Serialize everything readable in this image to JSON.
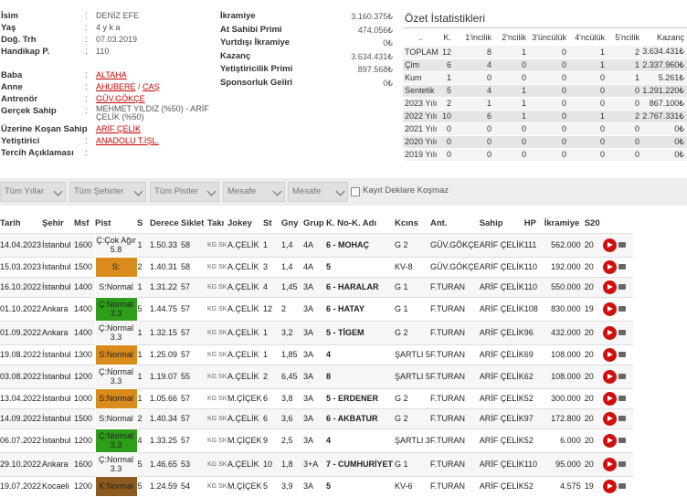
{
  "horse": {
    "name_label": "İsim",
    "name": "DENİZ EFE",
    "age_label": "Yaş",
    "age": "4 y k a",
    "birth_label": "Doğ. Trh",
    "birth": "07.03.2019",
    "hcap_label": "Handikap P.",
    "hcap": "110",
    "father_label": "Baba",
    "father": "ALTAHA",
    "mother_label": "Anne",
    "mother1": "AHUBERE",
    "mother_sep": " / ",
    "mother2": "CAŞ",
    "trainer_label": "Antrenör",
    "trainer": "GÜV.GÖKÇE",
    "owner_label": "Gerçek Sahip",
    "owner": "MEHMET YILDIZ (%50) - ARİF ÇELİK (%50)",
    "runner_label": "Üzerine Koşan Sahip",
    "runner": "ARİF ÇELİK",
    "breeder_label": "Yetiştirici",
    "breeder": "ANADOLU T.İŞL.",
    "pref_label": "Tercih Açıklaması",
    "pref": ""
  },
  "prizes": [
    {
      "label": "İkramiye",
      "value": "3.160.375₺"
    },
    {
      "label": "At Sahibi Primi",
      "value": "474.056₺"
    },
    {
      "label": "Yurtdışı İkramiye",
      "value": "0₺"
    },
    {
      "label": "Kazanç",
      "value": "3.634.431₺"
    },
    {
      "label": "Yetiştiricilik Primi",
      "value": "897.568₺"
    },
    {
      "label": "Sponsorluk Geliri",
      "value": "0₺"
    }
  ],
  "stats": {
    "title": "Özet İstatistikleri",
    "headers": [
      "..",
      "K.",
      "1'incilik",
      "2'ncilik",
      "3'üncülük",
      "4'ncülük",
      "5'ncilik",
      "Kazanç"
    ],
    "rows": [
      [
        "TOPLAM",
        "12",
        "8",
        "1",
        "0",
        "1",
        "2",
        "3.634.431₺"
      ],
      [
        "Çim",
        "6",
        "4",
        "0",
        "0",
        "1",
        "1",
        "2.337.960₺"
      ],
      [
        "Kum",
        "1",
        "0",
        "0",
        "0",
        "0",
        "1",
        "5.261₺"
      ],
      [
        "Sentetik",
        "5",
        "4",
        "1",
        "0",
        "0",
        "0",
        "1.291.220₺"
      ],
      [
        "2023 Yılı",
        "2",
        "1",
        "1",
        "0",
        "0",
        "0",
        "867.100₺"
      ],
      [
        "2022 Yılı",
        "10",
        "6",
        "1",
        "0",
        "1",
        "2",
        "2.767.331₺"
      ],
      [
        "2021 Yılı",
        "0",
        "0",
        "0",
        "0",
        "0",
        "0",
        "0₺"
      ],
      [
        "2020 Yılı",
        "0",
        "0",
        "0",
        "0",
        "0",
        "0",
        "0₺"
      ],
      [
        "2019 Yılı",
        "0",
        "0",
        "0",
        "0",
        "0",
        "0",
        "0₺"
      ]
    ]
  },
  "filters": {
    "years": "Tüm Yıllar",
    "cities": "Tüm Şehirler",
    "tracks": "Tüm Pistler",
    "dist1": "Mesafe",
    "dist2": "Mesafe",
    "checkbox_label": "Kayıt Deklare Koşmaz"
  },
  "grid": {
    "headers": [
      "Tarih",
      "Şehir",
      "Msf",
      "Pist",
      "S",
      "Derece",
      "Siklet",
      "Takı",
      "Jokey",
      "St",
      "Gny",
      "Grup",
      "K. No-K. Adı",
      "Kcıns",
      "Ant.",
      "Sahip",
      "HP",
      "İkramiye",
      "S20"
    ],
    "rows": [
      {
        "d": "14.04.2023",
        "c": "İstanbul",
        "m": "1600",
        "p": "Ç:Çok Ağır 5.8",
        "pc": "g",
        "s": "1",
        "dr": "1.50.33",
        "sk": "58",
        "t": "KG SK",
        "j": "A.ÇELİK",
        "st": "1",
        "g": "1,4",
        "gr": "4A",
        "k": "6 - MOHAÇ",
        "kc": "G 2",
        "a": "GÜV.GÖKÇE",
        "sa": "ARİF ÇELİK",
        "hp": "111",
        "ik": "562.000",
        "s20": "20"
      },
      {
        "d": "15.03.2023",
        "c": "İstanbul",
        "m": "1500",
        "p": "S:",
        "pc": "b",
        "s": "2",
        "dr": "1.40.31",
        "sk": "58",
        "t": "KG SK",
        "j": "A.ÇELİK",
        "st": "3",
        "g": "1,4",
        "gr": "4A",
        "k": "5",
        "kc": "KV-8",
        "a": "GÜV.GÖKÇE",
        "sa": "ARİF ÇELİK",
        "hp": "110",
        "ik": "192.000",
        "s20": "20"
      },
      {
        "d": "16.10.2022",
        "c": "İstanbul",
        "m": "1400",
        "p": "S:Normal",
        "pc": "b",
        "s": "1",
        "dr": "1.31.22",
        "sk": "57",
        "t": "KG SK",
        "j": "A.ÇELİK",
        "st": "4",
        "g": "1,45",
        "gr": "3A",
        "k": "6 - HARALAR",
        "kc": "G 1",
        "a": "F.TURAN",
        "sa": "ARİF ÇELİK",
        "hp": "110",
        "ik": "550.000",
        "s20": "20"
      },
      {
        "d": "01.10.2022",
        "c": "Ankara",
        "m": "1400",
        "p": "Ç:Normal 3.3",
        "pc": "g",
        "s": "5",
        "dr": "1.44.75",
        "sk": "57",
        "t": "KG SK",
        "j": "A.ÇELİK",
        "st": "12",
        "g": "2",
        "gr": "3A",
        "k": "6 - HATAY",
        "kc": "G 1",
        "a": "F.TURAN",
        "sa": "ARİF ÇELİK",
        "hp": "108",
        "ik": "830.000",
        "s20": "19"
      },
      {
        "d": "01.09.2022",
        "c": "Ankara",
        "m": "1400",
        "p": "Ç:Normal 3.3",
        "pc": "g",
        "s": "1",
        "dr": "1.32.15",
        "sk": "57",
        "t": "KG SK",
        "j": "A.ÇELİK",
        "st": "1",
        "g": "3,2",
        "gr": "3A",
        "k": "5 - TİGEM",
        "kc": "G 2",
        "a": "F.TURAN",
        "sa": "ARİF ÇELİK",
        "hp": "96",
        "ik": "432.000",
        "s20": "20"
      },
      {
        "d": "19.08.2022",
        "c": "İstanbul",
        "m": "1300",
        "p": "S:Normal",
        "pc": "b",
        "s": "1",
        "dr": "1.25.09",
        "sk": "57",
        "t": "KG SK",
        "j": "A.ÇELİK",
        "st": "1",
        "g": "1,85",
        "gr": "3A",
        "k": "4",
        "kc": "ŞARTLI 5",
        "a": "F.TURAN",
        "sa": "ARİF ÇELİK",
        "hp": "69",
        "ik": "108.000",
        "s20": "20"
      },
      {
        "d": "03.08.2022",
        "c": "İstanbul",
        "m": "1200",
        "p": "Ç:Normal 3.3",
        "pc": "g",
        "s": "1",
        "dr": "1.19.07",
        "sk": "55",
        "t": "KG SK",
        "j": "A.ÇELİK",
        "st": "2",
        "g": "6,45",
        "gr": "3A",
        "k": "8",
        "kc": "ŞARTLI 5",
        "a": "F.TURAN",
        "sa": "ARİF ÇELİK",
        "hp": "62",
        "ik": "108.000",
        "s20": "20"
      },
      {
        "d": "13.04.2022",
        "c": "İstanbul",
        "m": "1000",
        "p": "S:Normal",
        "pc": "b",
        "s": "1",
        "dr": "1.05.66",
        "sk": "57",
        "t": "KG SK",
        "j": "M.ÇİÇEK",
        "st": "6",
        "g": "3,8",
        "gr": "3A",
        "k": "5 - ERDENER",
        "kc": "G 2",
        "a": "F.TURAN",
        "sa": "ARİF ÇELİK",
        "hp": "52",
        "ik": "300.000",
        "s20": "20"
      },
      {
        "d": "14.09.2022",
        "c": "İstanbul",
        "m": "1500",
        "p": "S:Normal",
        "pc": "b",
        "s": "2",
        "dr": "1.40.34",
        "sk": "57",
        "t": "KG SK",
        "j": "A.ÇELİK",
        "st": "6",
        "g": "3,6",
        "gr": "3A",
        "k": "6 - AKBATUR",
        "kc": "G 2",
        "a": "F.TURAN",
        "sa": "ARİF ÇELİK",
        "hp": "97",
        "ik": "172.800",
        "s20": "20"
      },
      {
        "d": "06.07.2022",
        "c": "İstanbul",
        "m": "1200",
        "p": "Ç:Normal 3.3",
        "pc": "g",
        "s": "4",
        "dr": "1.33.25",
        "sk": "57",
        "t": "KG SK",
        "j": "M.ÇİÇEK",
        "st": "9",
        "g": "2,5",
        "gr": "3A",
        "k": "4",
        "kc": "ŞARTLI 3",
        "a": "F.TURAN",
        "sa": "ARİF ÇELİK",
        "hp": "52",
        "ik": "6.000",
        "s20": "20"
      },
      {
        "d": "29.10.2022",
        "c": "Ankara",
        "m": "1600",
        "p": "Ç:Normal 3.3",
        "pc": "g",
        "s": "5",
        "dr": "1.46.65",
        "sk": "53",
        "t": "KG SK",
        "j": "A.ÇELİK",
        "st": "10",
        "g": "1,8",
        "gr": "3+A",
        "k": "7 - CUMHURİYET",
        "kc": "G 1",
        "a": "F.TURAN",
        "sa": "ARİF ÇELİK",
        "hp": "110",
        "ik": "95.000",
        "s20": "20"
      },
      {
        "d": "19.07.2022",
        "c": "Kocaeli",
        "m": "1200",
        "p": "K:Normal",
        "pc": "k",
        "s": "5",
        "dr": "1.24.59",
        "sk": "54",
        "t": "KG SK",
        "j": "M.ÇİÇEK",
        "st": "5",
        "g": "3,9",
        "gr": "3A",
        "k": "5",
        "kc": "KV-6",
        "a": "F.TURAN",
        "sa": "ARİF ÇELİK",
        "hp": "52",
        "ik": "4.575",
        "s20": "19"
      }
    ]
  }
}
